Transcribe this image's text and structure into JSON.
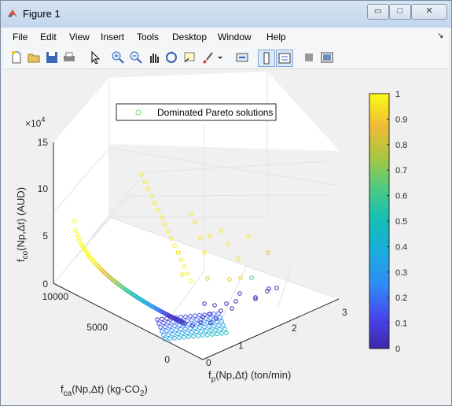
{
  "window": {
    "title": "Figure 1",
    "minimize": "▭",
    "maximize": "□",
    "close": "✕"
  },
  "menu": [
    "File",
    "Edit",
    "View",
    "Insert",
    "Tools",
    "Desktop",
    "Window",
    "Help"
  ],
  "menu_arrow": "↘",
  "toolbar_icons": [
    "new-figure-icon",
    "open-file-icon",
    "save-icon",
    "print-icon",
    "select-arrow-icon",
    "zoom-in-icon",
    "zoom-out-icon",
    "pan-icon",
    "rotate-3d-icon",
    "data-cursor-icon",
    "brush-icon",
    "brush-dropdown-icon",
    "link-plot-icon",
    "colorbar-toggle-icon",
    "legend-toggle-icon",
    "hide-plot-tools-icon",
    "show-plot-tools-icon"
  ],
  "colors": {
    "titlebar": "#c8daf0",
    "dominated_marker": "#6ddc6d"
  },
  "plot": {
    "z_exponent_base": "×10",
    "z_exponent_power": "4",
    "z_label_main": "f",
    "z_label_sub": "co",
    "z_label_rest": "(Np,Δt)  (AUD)",
    "x_label_main": "f",
    "x_label_sub": "p",
    "x_label_rest": "(Np,Δt)  (ton/min)",
    "y_label_main": "f",
    "y_label_sub": "ca",
    "y_label_rest": "(Np,Δt)  (kg-CO",
    "y_label_sub2": "2",
    "y_label_end": ")",
    "legend_label": "Dominated Pareto solutions"
  },
  "chart_data": {
    "type": "scatter",
    "x_ticks": [
      "0",
      "1",
      "2",
      "3"
    ],
    "y_ticks": [
      "0",
      "5000",
      "10000"
    ],
    "z_ticks": [
      "0",
      "5",
      "10",
      "15"
    ],
    "z_scale": "×10^4",
    "xlim": [
      0,
      3
    ],
    "ylim": [
      0,
      10000
    ],
    "zlim": [
      0,
      150000
    ],
    "colorbar": {
      "ticks": [
        "0",
        "0.1",
        "0.2",
        "0.3",
        "0.4",
        "0.5",
        "0.6",
        "0.7",
        "0.8",
        "0.9",
        "1"
      ],
      "colormap": "parula"
    },
    "legend": [
      "Dominated Pareto solutions"
    ]
  }
}
